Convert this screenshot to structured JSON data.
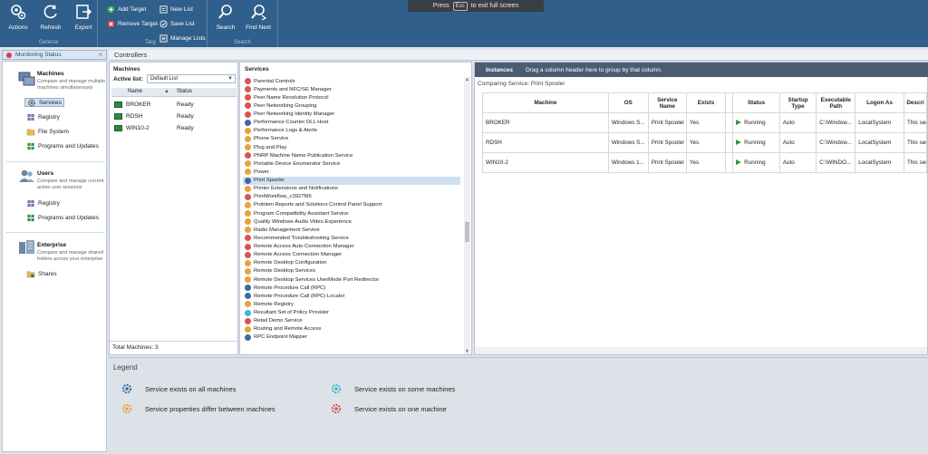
{
  "banner": {
    "pre": "Press",
    "key": "Esc",
    "post": "to exit full screen"
  },
  "ribbon": {
    "general": {
      "label": "General",
      "actions": "Actions",
      "refresh": "Refresh",
      "export": "Export"
    },
    "target": {
      "label": "Targ",
      "add": "Add Target",
      "remove": "Remove Target",
      "new_list": "New List",
      "save_list": "Save List",
      "manage_lists": "Manage Lists"
    },
    "search": {
      "label": "Search",
      "search": "Search",
      "find_next": "Find Next"
    }
  },
  "nav": {
    "header": "Monitoring Status",
    "collapse_glyph": "«",
    "machines": {
      "title": "Machines",
      "desc": "Compare and manage multiple machines simultaneously",
      "items": [
        "Services",
        "Registry",
        "File System",
        "Programs and Updates"
      ]
    },
    "users": {
      "title": "Users",
      "desc": "Compare and manage current active user sessions",
      "items": [
        "Registry",
        "Programs and Updates"
      ]
    },
    "enterprise": {
      "title": "Enterprise",
      "desc": "Compare and manage shared folders across your enterprise",
      "items": [
        "Shares"
      ]
    }
  },
  "controllers_title": "Controllers",
  "machines_panel": {
    "title": "Machines",
    "active_list_label": "Active list:",
    "active_list_value": "Default List",
    "columns": [
      "Name",
      "Status"
    ],
    "rows": [
      {
        "name": "BROKER",
        "status": "Ready"
      },
      {
        "name": "RDSH",
        "status": "Ready"
      },
      {
        "name": "WIN10-2",
        "status": "Ready"
      }
    ],
    "total": "Total Machines: 3"
  },
  "services_panel": {
    "title": "Services",
    "selected": "Print Spooler",
    "items": [
      {
        "name": "Parental Controls",
        "kind": "one"
      },
      {
        "name": "Payments and NFC/SE Manager",
        "kind": "one"
      },
      {
        "name": "Peer Name Resolution Protocol",
        "kind": "one"
      },
      {
        "name": "Peer Networking Grouping",
        "kind": "one"
      },
      {
        "name": "Peer Networking Identity Manager",
        "kind": "one"
      },
      {
        "name": "Performance Counter DLL Host",
        "kind": "all"
      },
      {
        "name": "Performance Logs & Alerts",
        "kind": "differ"
      },
      {
        "name": "Phone Service",
        "kind": "differ"
      },
      {
        "name": "Plug and Play",
        "kind": "differ"
      },
      {
        "name": "PNRP Machine Name Publication Service",
        "kind": "one"
      },
      {
        "name": "Portable Device Enumerator Service",
        "kind": "differ"
      },
      {
        "name": "Power",
        "kind": "differ"
      },
      {
        "name": "Print Spooler",
        "kind": "all"
      },
      {
        "name": "Printer Extensions and Notifications",
        "kind": "differ"
      },
      {
        "name": "PrintWorkflow_c3927f95",
        "kind": "one"
      },
      {
        "name": "Problem Reports and Solutions Control Panel Support",
        "kind": "differ"
      },
      {
        "name": "Program Compatibility Assistant Service",
        "kind": "differ"
      },
      {
        "name": "Quality Windows Audio Video Experience",
        "kind": "differ"
      },
      {
        "name": "Radio Management Service",
        "kind": "differ"
      },
      {
        "name": "Recommended Troubleshooting Service",
        "kind": "one"
      },
      {
        "name": "Remote Access Auto Connection Manager",
        "kind": "one"
      },
      {
        "name": "Remote Access Connection Manager",
        "kind": "one"
      },
      {
        "name": "Remote Desktop Configuration",
        "kind": "differ"
      },
      {
        "name": "Remote Desktop Services",
        "kind": "differ"
      },
      {
        "name": "Remote Desktop Services UserMode Port Redirector",
        "kind": "differ"
      },
      {
        "name": "Remote Procedure Call (RPC)",
        "kind": "all"
      },
      {
        "name": "Remote Procedure Call (RPC) Locator",
        "kind": "all"
      },
      {
        "name": "Remote Registry",
        "kind": "differ"
      },
      {
        "name": "Resultant Set of Policy Provider",
        "kind": "some"
      },
      {
        "name": "Retail Demo Service",
        "kind": "one"
      },
      {
        "name": "Routing and Remote Access",
        "kind": "differ"
      },
      {
        "name": "RPC Endpoint Mapper",
        "kind": "all"
      }
    ],
    "scroll_up": "▲",
    "scroll_down": "▼"
  },
  "instances_panel": {
    "title": "Instances",
    "group_hint": "Drag a column header here to group by that column.",
    "comparing": "Comparing Service: Print Spooler",
    "columns": [
      "Machine",
      "OS",
      "Service Name",
      "Exists",
      "",
      "Status",
      "Startup Type",
      "Executable Path",
      "Logon As",
      "Descri"
    ],
    "rows": [
      [
        "BROKER",
        "Windows S...",
        "Print Spooler",
        "Yes",
        "",
        "Running",
        "Auto",
        "C:\\Window...",
        "LocalSystem",
        "This ser"
      ],
      [
        "RDSH",
        "Windows S...",
        "Print Spooler",
        "Yes",
        "",
        "Running",
        "Auto",
        "C:\\Window...",
        "LocalSystem",
        "This ser"
      ],
      [
        "WIN10-2",
        "Windows 1...",
        "Print Spooler",
        "Yes",
        "",
        "Running",
        "Auto",
        "C:\\WINDO...",
        "LocalSystem",
        "This ser"
      ]
    ]
  },
  "legend": {
    "title": "Legend",
    "all": "Service exists on all machines",
    "differ": "Service properties differ between machines",
    "some": "Service exists on some machines",
    "one": "Service exists on one machine"
  },
  "colors": {
    "ribbon": "#2f5f8a",
    "one_machine": "#e05050",
    "differ": "#e8a23a",
    "all_machines": "#3b6aa0",
    "some_machines": "#3fb7c9",
    "running": "#2e9a3a"
  }
}
